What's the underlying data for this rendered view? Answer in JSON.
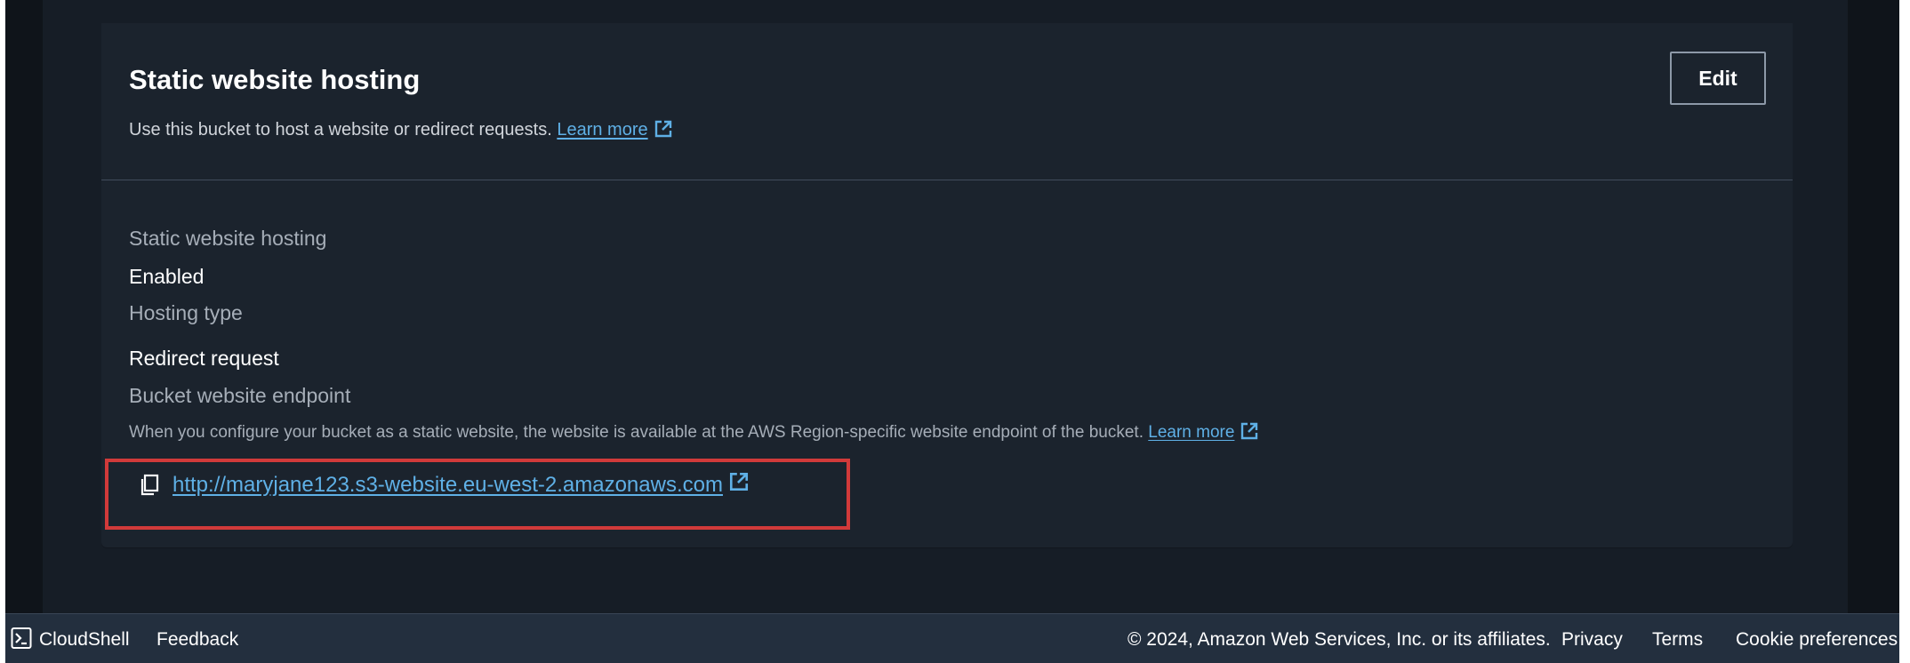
{
  "panel": {
    "title": "Static website hosting",
    "description": "Use this bucket to host a website or redirect requests.",
    "learn_more": "Learn more",
    "edit_label": "Edit"
  },
  "details": {
    "hosting_label": "Static website hosting",
    "hosting_value": "Enabled",
    "type_label": "Hosting type",
    "type_value": "Redirect request",
    "endpoint_label": "Bucket website endpoint",
    "endpoint_note": "When you configure your bucket as a static website, the website is available at the AWS Region-specific website endpoint of the bucket.",
    "endpoint_learn_more": "Learn more",
    "endpoint_url": "http://maryjane123.s3-website.eu-west-2.amazonaws.com"
  },
  "footer": {
    "cloudshell": "CloudShell",
    "feedback": "Feedback",
    "copyright": "© 2024, Amazon Web Services, Inc. or its affiliates.",
    "privacy": "Privacy",
    "terms": "Terms",
    "cookie": "Cookie preferences"
  },
  "colors": {
    "link": "#5fb0e6",
    "highlight": "#d13a3a",
    "panel_bg": "#1b232d",
    "footer_bg": "#232f3e"
  },
  "icons": [
    "external-link-icon",
    "copy-icon",
    "cloudshell-icon"
  ]
}
